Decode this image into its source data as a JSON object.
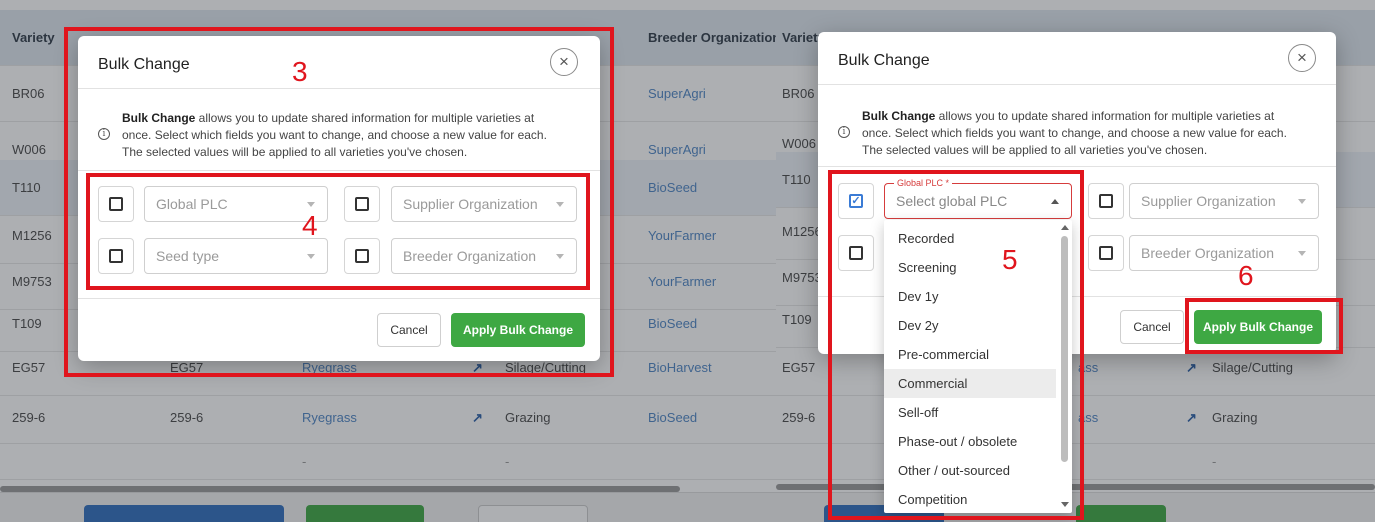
{
  "left": {
    "table": {
      "col_variety": "Variety",
      "col_breeder": "Breeder Organization",
      "rows": [
        {
          "variety": "BR06",
          "breeder": "SuperAgri"
        },
        {
          "variety": "W006",
          "breeder": "SuperAgri"
        },
        {
          "variety": "T110",
          "breeder": "BioSeed"
        },
        {
          "variety": "M1256",
          "breeder": "YourFarmer"
        },
        {
          "variety": "M9753",
          "breeder": "YourFarmer"
        },
        {
          "variety": "T109",
          "breeder": "BioSeed"
        },
        {
          "variety": "EG57",
          "name": "EG57",
          "species": "Ryegrass",
          "arrow": "↗",
          "use": "Silage/Cutting",
          "breeder": "BioHarvest"
        },
        {
          "variety": "259-6",
          "name": "259-6",
          "species": "Ryegrass",
          "arrow": "↗",
          "use": "Grazing",
          "breeder": "BioSeed"
        }
      ],
      "empty_row_dash_1": "-",
      "empty_row_dash_2": "-"
    },
    "modal": {
      "title": "Bulk Change",
      "close_icon": "×",
      "info_icon": "i",
      "info_bold": "Bulk Change",
      "info_line1": " allows you to update shared information for multiple varieties at",
      "info_line2": "once. Select which fields you want to change, and choose a new value for each.",
      "info_line3": "The selected values will be applied to all varieties you've chosen.",
      "field_global_plc": "Global PLC",
      "field_supplier": "Supplier Organization",
      "field_seed_type": "Seed type",
      "field_breeder": "Breeder Organization",
      "cancel_label": "Cancel",
      "apply_label": "Apply Bulk Change"
    },
    "step_a": "3",
    "step_b": "4"
  },
  "right": {
    "table": {
      "col_variety": "Variety",
      "rows": [
        {
          "variety": "BR06"
        },
        {
          "variety": "W006"
        },
        {
          "variety": "T110"
        },
        {
          "variety": "M1256"
        },
        {
          "variety": "M9753"
        },
        {
          "variety": "T109"
        },
        {
          "variety": "EG57",
          "species_tail": "ass",
          "arrow": "↗",
          "use": "Silage/Cutting"
        },
        {
          "variety": "259-6",
          "species_tail": "ass",
          "arrow": "↗",
          "use": "Grazing"
        }
      ],
      "empty_row_dash": "-"
    },
    "modal": {
      "title": "Bulk Change",
      "close_icon": "×",
      "info_icon": "i",
      "info_bold": "Bulk Change",
      "info_line1": " allows you to update shared information for multiple varieties at",
      "info_line2": "once. Select which fields you want to change, and choose a new value for each.",
      "info_line3": "The selected values will be applied to all varieties you've chosen.",
      "global_plc_label": "Global PLC *",
      "global_plc_placeholder": "Select global PLC",
      "field_supplier": "Supplier Organization",
      "field_breeder": "Breeder Organization",
      "cancel_label": "Cancel",
      "apply_label": "Apply Bulk Change"
    },
    "dropdown_options": [
      "Recorded",
      "Screening",
      "Dev 1y",
      "Dev 2y",
      "Pre-commercial",
      "Commercial",
      "Sell-off",
      "Phase-out / obsolete",
      "Other / out-sourced",
      "Competition"
    ],
    "highlighted_option": "Commercial",
    "step_a": "5",
    "step_b": "6"
  },
  "colors": {
    "annotation_red": "#e0151d",
    "apply_green": "#3ea843",
    "link_blue": "#4f86c6",
    "checkbox_blue": "#3a7bd5"
  }
}
